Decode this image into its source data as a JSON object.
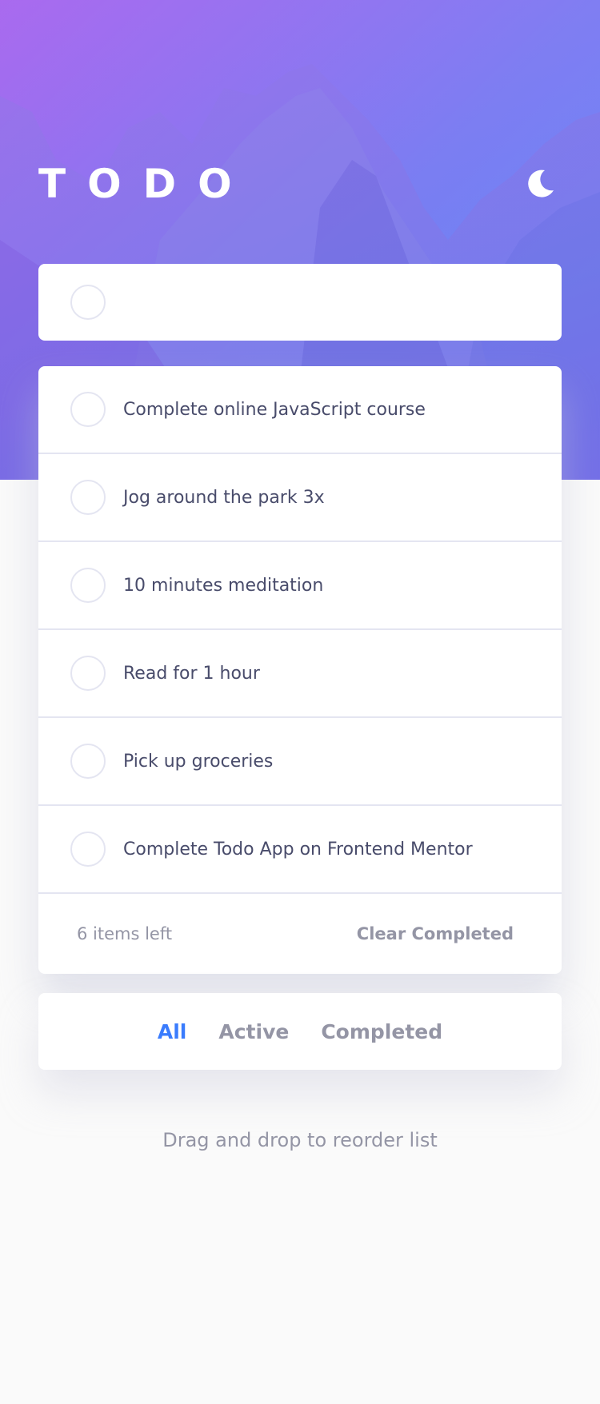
{
  "app": {
    "logo": "TODO",
    "theme_toggle_icon": "moon-icon"
  },
  "new_todo": {
    "value": "",
    "placeholder": ""
  },
  "todos": [
    {
      "text": "Complete online JavaScript course",
      "completed": false
    },
    {
      "text": "Jog around the park 3x",
      "completed": false
    },
    {
      "text": "10 minutes meditation",
      "completed": false
    },
    {
      "text": "Read for 1 hour",
      "completed": false
    },
    {
      "text": "Pick up groceries",
      "completed": false
    },
    {
      "text": "Complete Todo App on Frontend Mentor",
      "completed": false
    }
  ],
  "footer": {
    "items_left": "6 items left",
    "clear_completed": "Clear Completed"
  },
  "filters": {
    "all": "All",
    "active": "Active",
    "completed": "Completed",
    "selected": "All"
  },
  "hint": "Drag and drop to reorder list",
  "colors": {
    "accent": "#3a7cfd",
    "text": "#494c6b",
    "muted": "#9495a5",
    "border": "#e4e5f1",
    "gradient_start": "#a868ee",
    "gradient_end": "#6e95ff"
  }
}
